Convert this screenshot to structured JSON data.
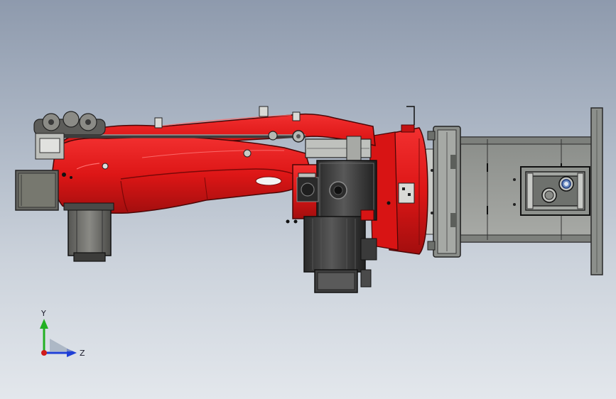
{
  "triad": {
    "y_axis_label": "Y",
    "z_axis_label": "Z"
  },
  "colors": {
    "background_top": "#8e9aad",
    "background_bottom": "#e3e7ec",
    "robot_red": "#e01818",
    "robot_red_dark": "#a80f0f",
    "motor_gray": "#6a6a66",
    "motor_dark": "#2c2c2c",
    "base_gray": "#9a9c98",
    "axis_y": "#22b022",
    "axis_z": "#1f3fd6",
    "axis_x": "#d11a1a"
  }
}
